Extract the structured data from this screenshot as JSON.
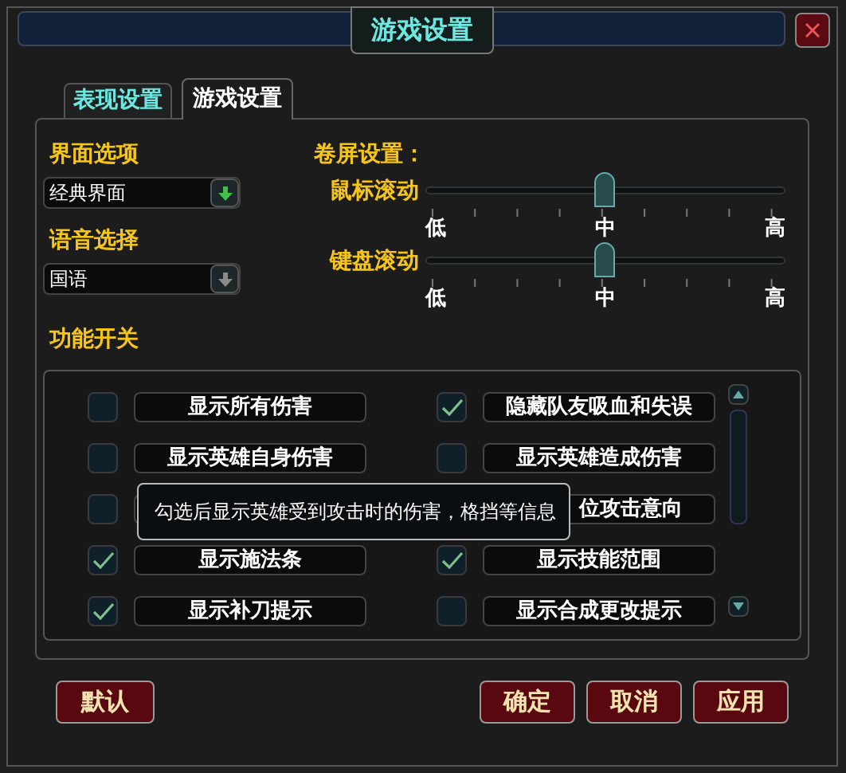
{
  "window": {
    "title": "游戏设置"
  },
  "tabs": [
    {
      "label": "表现设置",
      "selected": false
    },
    {
      "label": "游戏设置",
      "selected": true
    }
  ],
  "interface_options": {
    "label": "界面选项",
    "dropdown": {
      "value": "经典界面",
      "highlighted": true
    }
  },
  "voice_selection": {
    "label": "语音选择",
    "dropdown": {
      "value": "国语",
      "highlighted": false
    }
  },
  "scroll_settings": {
    "title": "卷屏设置：",
    "sliders": [
      {
        "label": "鼠标滚动",
        "level": 0.5,
        "low": "低",
        "mid": "中",
        "high": "高"
      },
      {
        "label": "键盘滚动",
        "level": 0.5,
        "low": "低",
        "mid": "中",
        "high": "高"
      }
    ]
  },
  "features": {
    "title": "功能开关",
    "options": [
      {
        "label": "显示所有伤害",
        "checked": false
      },
      {
        "label": "隐藏队友吸血和失误",
        "checked": true
      },
      {
        "label": "显示英雄自身伤害",
        "checked": false
      },
      {
        "label": "显示英雄造成伤害",
        "checked": false
      },
      {
        "checked": false
      },
      {
        "label": "位攻击意向"
      },
      {
        "label": "显示施法条",
        "checked": true
      },
      {
        "label": "显示技能范围",
        "checked": true
      },
      {
        "label": "显示补刀提示",
        "checked": true
      },
      {
        "label": "显示合成更改提示",
        "checked": false
      }
    ],
    "tooltip": "勾选后显示英雄受到攻击时的伤害，格挡等信息"
  },
  "buttons_left": [
    "默认"
  ],
  "buttons_right": [
    "确定",
    "取消",
    "应用"
  ]
}
